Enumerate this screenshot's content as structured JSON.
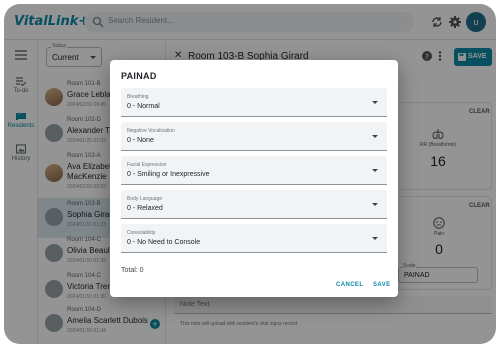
{
  "app": {
    "logo": "VitalLink+",
    "search_placeholder": "Search Resident...",
    "user_initials": "u"
  },
  "rail": {
    "items": [
      {
        "label": "To-do",
        "icon": "todo-icon",
        "active": false
      },
      {
        "label": "Residents",
        "icon": "residents-icon",
        "active": true
      },
      {
        "label": "History",
        "icon": "history-icon",
        "active": false
      }
    ]
  },
  "list": {
    "status_label": "Status",
    "status_value": "Current",
    "residents": [
      {
        "room": "Room 101-B",
        "name": "Grace Leblanc",
        "date": "2024/02/16 09:45",
        "photo": true
      },
      {
        "room": "Room 102-D",
        "name": "Alexander Tre",
        "date": "2024/01/25 01:03",
        "photo": false
      },
      {
        "room": "Room 103-A",
        "name": "Ava Elizabeth MacKenzie",
        "name_line1": "Ava Elizabeth",
        "name_line2": "MacKenzie",
        "date": "2024/02/15 09:53",
        "photo": true
      },
      {
        "room": "Room 103-B",
        "name": "Sophia Girard",
        "date": "2024/01/10 01:23",
        "photo": false
      },
      {
        "room": "Room 104-C",
        "name": "Olivia Beaulieu",
        "date": "2024/01/10 01:33",
        "photo": false
      },
      {
        "room": "Room 104-C",
        "name": "Victoria Tremb",
        "date": "2024/01/10 01:36",
        "photo": false
      },
      {
        "room": "Room 104-D",
        "name": "Amelia Scarlett Dubois",
        "date": "2024/01/10 01:34",
        "photo": false
      }
    ]
  },
  "detail": {
    "title": "Room 103-B Sophia Girard",
    "save_label": "SAVE",
    "clear_label": "CLEAR",
    "rr_label": "RR (Breath/min)",
    "rr_value": "16",
    "pain_label": "Pain",
    "pain_value": "0",
    "score_label": "Scale",
    "score_value": "PAINAD",
    "note_placeholder": "Note Text",
    "note_hint": "This note will upload with resident's vital signs record"
  },
  "modal": {
    "title": "PAINAD",
    "fields": [
      {
        "label": "Breathing",
        "value": "0 - Normal"
      },
      {
        "label": "Negative Vocalization",
        "value": "0 - None"
      },
      {
        "label": "Facial Expression",
        "value": "0 - Smiling or Inexpressive"
      },
      {
        "label": "Body Language",
        "value": "0 - Relaxed"
      },
      {
        "label": "Consolability",
        "value": "0 - No Need to Console"
      }
    ],
    "total": "Total: 0",
    "cancel_label": "CANCEL",
    "save_label": "SAVE"
  },
  "colors": {
    "accent": "#0b8aa5",
    "scrim": "rgba(0,0,0,0.42)"
  }
}
